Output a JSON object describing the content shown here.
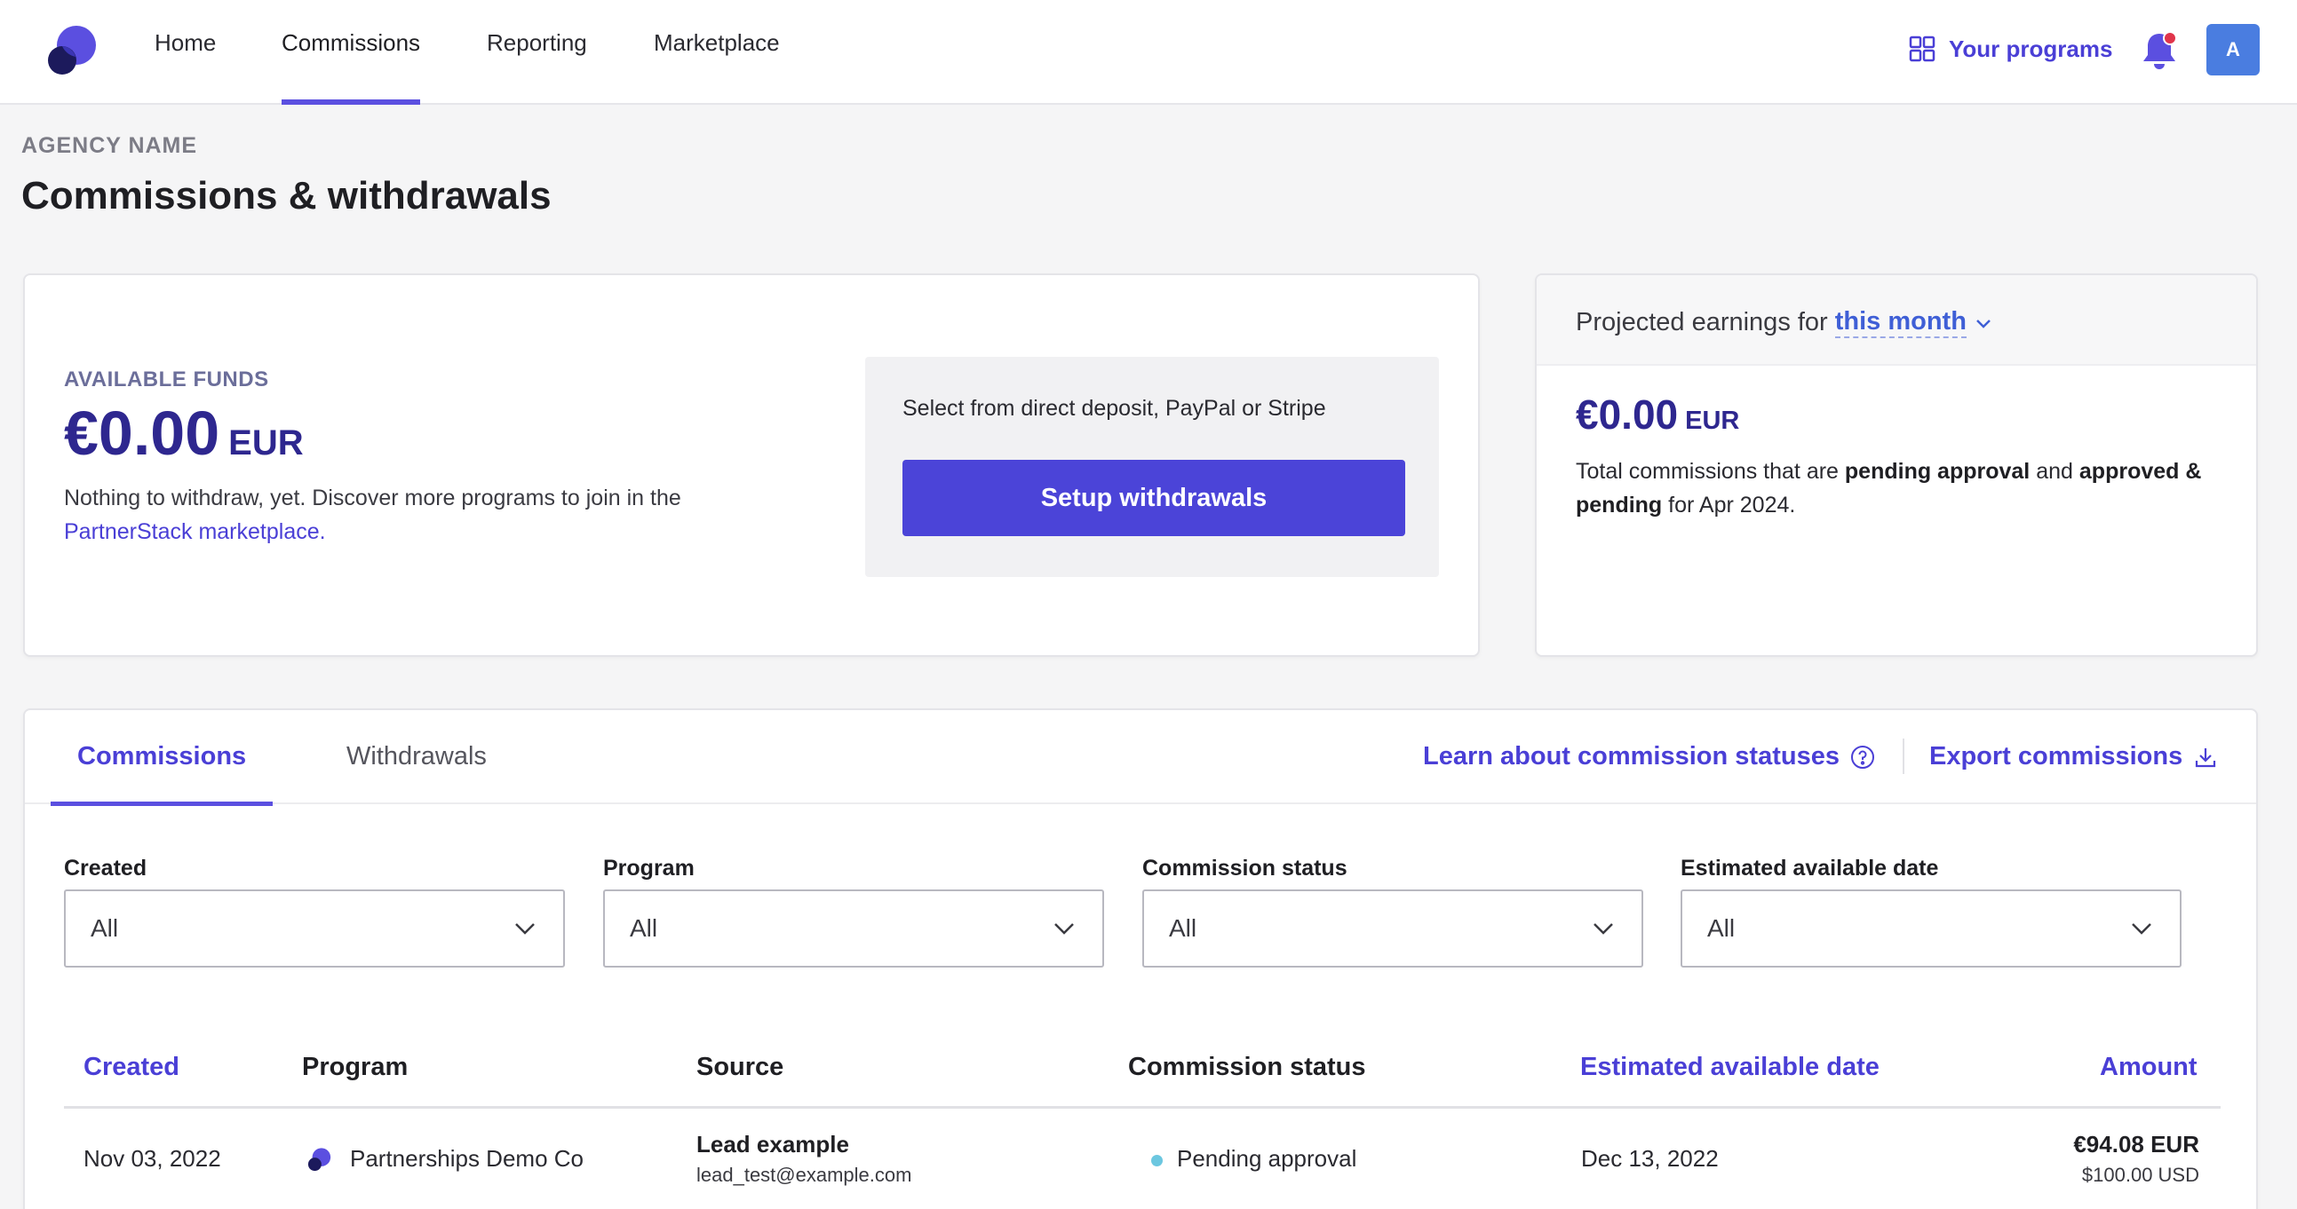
{
  "nav": {
    "items": [
      {
        "label": "Home"
      },
      {
        "label": "Commissions",
        "active": true
      },
      {
        "label": "Reporting"
      },
      {
        "label": "Marketplace"
      }
    ],
    "your_programs": "Your programs",
    "avatar_initial": "A",
    "icons": {
      "logo": "partnerstack-logo",
      "programs": "grid-icon",
      "bell": "bell-icon"
    },
    "notification_color": "#e0344a"
  },
  "header": {
    "agency": "AGENCY NAME",
    "title": "Commissions & withdrawals"
  },
  "funds": {
    "label": "AVAILABLE FUNDS",
    "amount": "€0.00",
    "currency": "EUR",
    "desc_prefix": "Nothing to withdraw, yet. Discover more programs to join in the",
    "desc_link": "PartnerStack marketplace.",
    "withdraw_text": "Select from direct deposit, PayPal or Stripe",
    "setup_button": "Setup withdrawals"
  },
  "projected": {
    "title_prefix": "Projected earnings for",
    "period": "this month",
    "amount": "€0.00",
    "currency": "EUR",
    "desc_1": "Total commissions that are",
    "desc_b1": "pending approval",
    "desc_2": "and",
    "desc_b2": "approved & pending",
    "desc_3": "for Apr 2024."
  },
  "tabs": {
    "commissions": "Commissions",
    "withdrawals": "Withdrawals",
    "learn_link": "Learn about commission statuses",
    "export_link": "Export commissions"
  },
  "filters": [
    {
      "label": "Created",
      "value": "All"
    },
    {
      "label": "Program",
      "value": "All"
    },
    {
      "label": "Commission status",
      "value": "All"
    },
    {
      "label": "Estimated available date",
      "value": "All"
    }
  ],
  "table": {
    "columns": {
      "created": "Created",
      "program": "Program",
      "source": "Source",
      "status": "Commission status",
      "available": "Estimated available date",
      "amount": "Amount"
    },
    "rows": [
      {
        "created": "Nov 03, 2022",
        "program": "Partnerships Demo Co",
        "source_name": "Lead example",
        "source_email": "lead_test@example.com",
        "status": "Pending approval",
        "available": "Dec 13, 2022",
        "amount": "€94.08 EUR",
        "amount_sub": "$100.00 USD"
      }
    ]
  },
  "colors": {
    "accent": "#4b44d8",
    "brand_text": "#2e278f",
    "status_pending": "#6cc7e0"
  }
}
